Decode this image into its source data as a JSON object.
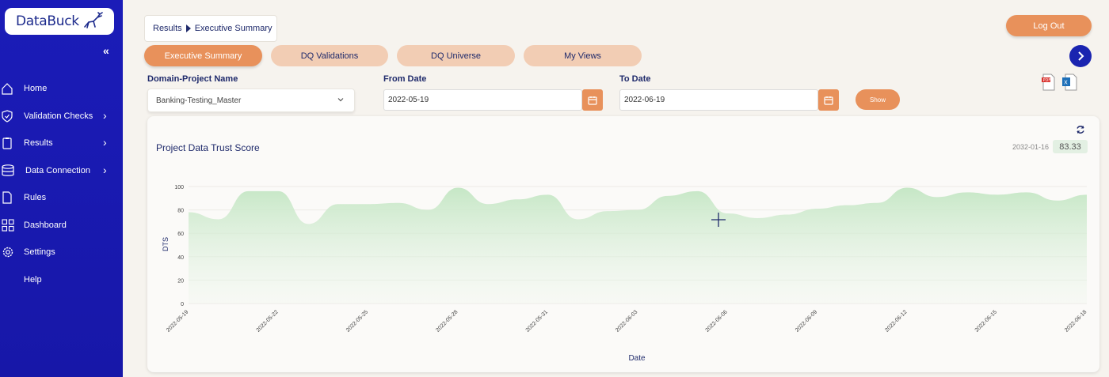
{
  "app": {
    "logo_text": "DataBuck"
  },
  "sidebar": {
    "collapse_icon": "double-chevron-left-icon",
    "items": [
      {
        "label": "Home",
        "icon": "home-icon",
        "has_submenu": false
      },
      {
        "label": "Validation Checks",
        "icon": "shield-icon",
        "has_submenu": true
      },
      {
        "label": "Results",
        "icon": "clipboard-icon",
        "has_submenu": true
      },
      {
        "label": "Data Connection",
        "icon": "database-icon",
        "has_submenu": true
      },
      {
        "label": "Rules",
        "icon": "document-icon",
        "has_submenu": false
      },
      {
        "label": "Dashboard",
        "icon": "grid-icon",
        "has_submenu": false
      },
      {
        "label": "Settings",
        "icon": "gear-icon",
        "has_submenu": false
      },
      {
        "label": "Help",
        "icon": "",
        "has_submenu": false
      }
    ]
  },
  "breadcrumb": {
    "parent": "Results",
    "current": "Executive Summary"
  },
  "header": {
    "logout_label": "Log Out"
  },
  "tabs": [
    {
      "label": "Executive Summary",
      "active": true
    },
    {
      "label": "DQ Validations",
      "active": false
    },
    {
      "label": "DQ Universe",
      "active": false
    },
    {
      "label": "My Views",
      "active": false
    }
  ],
  "filters": {
    "domain_label": "Domain-Project Name",
    "domain_value": "Banking-Testing_Master",
    "from_label": "From Date",
    "from_value": "2022-05-19",
    "to_label": "To Date",
    "to_value": "2022-06-19",
    "show_label": "Show"
  },
  "exports": {
    "pdf_icon": "pdf-file-icon",
    "excel_icon": "excel-file-icon"
  },
  "card": {
    "title": "Project Data Trust Score",
    "score_date": "2032-01-16",
    "score_value": "83.33"
  },
  "colors": {
    "sidebar": "#1a1ab3",
    "accent_orange": "#e8915b",
    "tab_inactive": "#f2cdb4",
    "area_fill": "#c8e8c8",
    "navy": "#1f2a6b"
  },
  "chart_data": {
    "type": "area",
    "xlabel": "Date",
    "ylabel": "DTS",
    "ylim": [
      0,
      100
    ],
    "yticks": [
      0,
      20,
      40,
      60,
      80,
      100
    ],
    "grid": true,
    "x_tick_labels": [
      "2022-05-19",
      "2022-05-22",
      "2022-05-25",
      "2022-05-28",
      "2022-05-31",
      "2022-06-03",
      "2022-06-06",
      "2022-06-09",
      "2022-06-12",
      "2022-06-15",
      "2022-06-18"
    ],
    "x": [
      "2022-05-19",
      "2022-05-20",
      "2022-05-21",
      "2022-05-22",
      "2022-05-23",
      "2022-05-24",
      "2022-05-25",
      "2022-05-26",
      "2022-05-27",
      "2022-05-28",
      "2022-05-29",
      "2022-05-30",
      "2022-05-31",
      "2022-06-01",
      "2022-06-02",
      "2022-06-03",
      "2022-06-04",
      "2022-06-05",
      "2022-06-06",
      "2022-06-07",
      "2022-06-08",
      "2022-06-09",
      "2022-06-10",
      "2022-06-11",
      "2022-06-12",
      "2022-06-13",
      "2022-06-14",
      "2022-06-15",
      "2022-06-16",
      "2022-06-17",
      "2022-06-18"
    ],
    "values": [
      78,
      72,
      96,
      96,
      68,
      85,
      85,
      86,
      80,
      99,
      85,
      89,
      93,
      72,
      79,
      80,
      92,
      96,
      77,
      73,
      76,
      81,
      84,
      86,
      99,
      91,
      95,
      93,
      95,
      88,
      93
    ]
  }
}
